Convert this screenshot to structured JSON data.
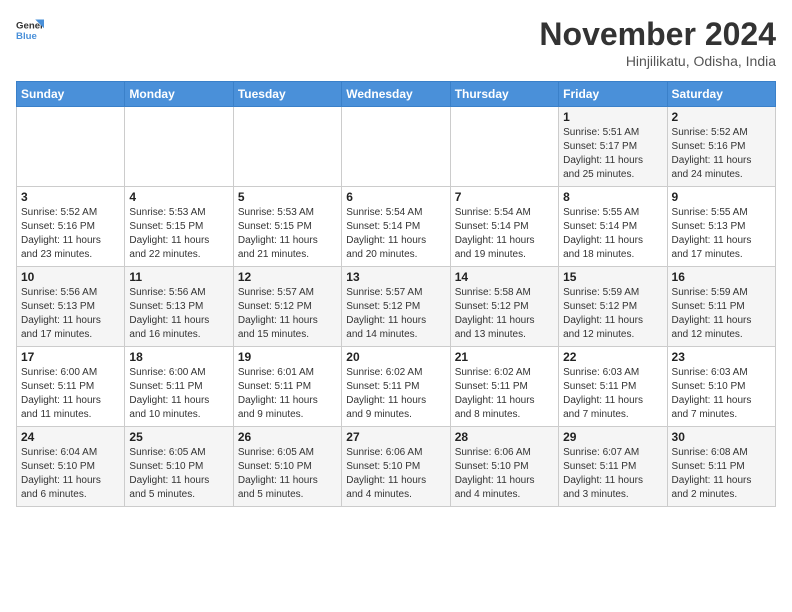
{
  "header": {
    "logo_line1": "General",
    "logo_line2": "Blue",
    "month": "November 2024",
    "location": "Hinjilikatu, Odisha, India"
  },
  "days_of_week": [
    "Sunday",
    "Monday",
    "Tuesday",
    "Wednesday",
    "Thursday",
    "Friday",
    "Saturday"
  ],
  "weeks": [
    [
      {
        "day": "",
        "info": ""
      },
      {
        "day": "",
        "info": ""
      },
      {
        "day": "",
        "info": ""
      },
      {
        "day": "",
        "info": ""
      },
      {
        "day": "",
        "info": ""
      },
      {
        "day": "1",
        "info": "Sunrise: 5:51 AM\nSunset: 5:17 PM\nDaylight: 11 hours\nand 25 minutes."
      },
      {
        "day": "2",
        "info": "Sunrise: 5:52 AM\nSunset: 5:16 PM\nDaylight: 11 hours\nand 24 minutes."
      }
    ],
    [
      {
        "day": "3",
        "info": "Sunrise: 5:52 AM\nSunset: 5:16 PM\nDaylight: 11 hours\nand 23 minutes."
      },
      {
        "day": "4",
        "info": "Sunrise: 5:53 AM\nSunset: 5:15 PM\nDaylight: 11 hours\nand 22 minutes."
      },
      {
        "day": "5",
        "info": "Sunrise: 5:53 AM\nSunset: 5:15 PM\nDaylight: 11 hours\nand 21 minutes."
      },
      {
        "day": "6",
        "info": "Sunrise: 5:54 AM\nSunset: 5:14 PM\nDaylight: 11 hours\nand 20 minutes."
      },
      {
        "day": "7",
        "info": "Sunrise: 5:54 AM\nSunset: 5:14 PM\nDaylight: 11 hours\nand 19 minutes."
      },
      {
        "day": "8",
        "info": "Sunrise: 5:55 AM\nSunset: 5:14 PM\nDaylight: 11 hours\nand 18 minutes."
      },
      {
        "day": "9",
        "info": "Sunrise: 5:55 AM\nSunset: 5:13 PM\nDaylight: 11 hours\nand 17 minutes."
      }
    ],
    [
      {
        "day": "10",
        "info": "Sunrise: 5:56 AM\nSunset: 5:13 PM\nDaylight: 11 hours\nand 17 minutes."
      },
      {
        "day": "11",
        "info": "Sunrise: 5:56 AM\nSunset: 5:13 PM\nDaylight: 11 hours\nand 16 minutes."
      },
      {
        "day": "12",
        "info": "Sunrise: 5:57 AM\nSunset: 5:12 PM\nDaylight: 11 hours\nand 15 minutes."
      },
      {
        "day": "13",
        "info": "Sunrise: 5:57 AM\nSunset: 5:12 PM\nDaylight: 11 hours\nand 14 minutes."
      },
      {
        "day": "14",
        "info": "Sunrise: 5:58 AM\nSunset: 5:12 PM\nDaylight: 11 hours\nand 13 minutes."
      },
      {
        "day": "15",
        "info": "Sunrise: 5:59 AM\nSunset: 5:12 PM\nDaylight: 11 hours\nand 12 minutes."
      },
      {
        "day": "16",
        "info": "Sunrise: 5:59 AM\nSunset: 5:11 PM\nDaylight: 11 hours\nand 12 minutes."
      }
    ],
    [
      {
        "day": "17",
        "info": "Sunrise: 6:00 AM\nSunset: 5:11 PM\nDaylight: 11 hours\nand 11 minutes."
      },
      {
        "day": "18",
        "info": "Sunrise: 6:00 AM\nSunset: 5:11 PM\nDaylight: 11 hours\nand 10 minutes."
      },
      {
        "day": "19",
        "info": "Sunrise: 6:01 AM\nSunset: 5:11 PM\nDaylight: 11 hours\nand 9 minutes."
      },
      {
        "day": "20",
        "info": "Sunrise: 6:02 AM\nSunset: 5:11 PM\nDaylight: 11 hours\nand 9 minutes."
      },
      {
        "day": "21",
        "info": "Sunrise: 6:02 AM\nSunset: 5:11 PM\nDaylight: 11 hours\nand 8 minutes."
      },
      {
        "day": "22",
        "info": "Sunrise: 6:03 AM\nSunset: 5:11 PM\nDaylight: 11 hours\nand 7 minutes."
      },
      {
        "day": "23",
        "info": "Sunrise: 6:03 AM\nSunset: 5:10 PM\nDaylight: 11 hours\nand 7 minutes."
      }
    ],
    [
      {
        "day": "24",
        "info": "Sunrise: 6:04 AM\nSunset: 5:10 PM\nDaylight: 11 hours\nand 6 minutes."
      },
      {
        "day": "25",
        "info": "Sunrise: 6:05 AM\nSunset: 5:10 PM\nDaylight: 11 hours\nand 5 minutes."
      },
      {
        "day": "26",
        "info": "Sunrise: 6:05 AM\nSunset: 5:10 PM\nDaylight: 11 hours\nand 5 minutes."
      },
      {
        "day": "27",
        "info": "Sunrise: 6:06 AM\nSunset: 5:10 PM\nDaylight: 11 hours\nand 4 minutes."
      },
      {
        "day": "28",
        "info": "Sunrise: 6:06 AM\nSunset: 5:10 PM\nDaylight: 11 hours\nand 4 minutes."
      },
      {
        "day": "29",
        "info": "Sunrise: 6:07 AM\nSunset: 5:11 PM\nDaylight: 11 hours\nand 3 minutes."
      },
      {
        "day": "30",
        "info": "Sunrise: 6:08 AM\nSunset: 5:11 PM\nDaylight: 11 hours\nand 2 minutes."
      }
    ]
  ]
}
